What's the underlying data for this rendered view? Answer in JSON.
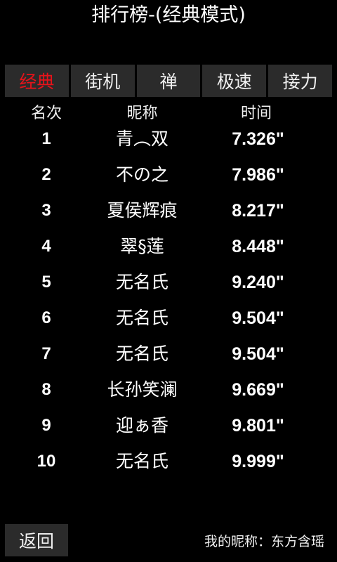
{
  "title": "排行榜-(经典模式)",
  "tabs": [
    {
      "label": "经典",
      "active": true
    },
    {
      "label": "街机",
      "active": false
    },
    {
      "label": "禅",
      "active": false
    },
    {
      "label": "极速",
      "active": false
    },
    {
      "label": "接力",
      "active": false
    }
  ],
  "table": {
    "headers": {
      "rank": "名次",
      "name": "昵称",
      "time": "时间"
    },
    "rows": [
      {
        "rank": "1",
        "name": "青︵双",
        "time": "7.326\""
      },
      {
        "rank": "2",
        "name": "不の之",
        "time": "7.986\""
      },
      {
        "rank": "3",
        "name": "夏侯辉痕",
        "time": "8.217\""
      },
      {
        "rank": "4",
        "name": "翠§莲",
        "time": "8.448\""
      },
      {
        "rank": "5",
        "name": "无名氏",
        "time": "9.240\""
      },
      {
        "rank": "6",
        "name": "无名氏",
        "time": "9.504\""
      },
      {
        "rank": "7",
        "name": "无名氏",
        "time": "9.504\""
      },
      {
        "rank": "8",
        "name": "长孙笑澜",
        "time": "9.669\""
      },
      {
        "rank": "9",
        "name": "迎ぁ香",
        "time": "9.801\""
      },
      {
        "rank": "10",
        "name": "无名氏",
        "time": "9.999\""
      }
    ]
  },
  "footer": {
    "back_label": "返回",
    "nickname_text": "我的昵称：东方含瑶"
  },
  "colors": {
    "background": "#000000",
    "tab_bg": "#2b2b2b",
    "active_tab_text": "#e8131a",
    "text": "#f0f0f0"
  }
}
